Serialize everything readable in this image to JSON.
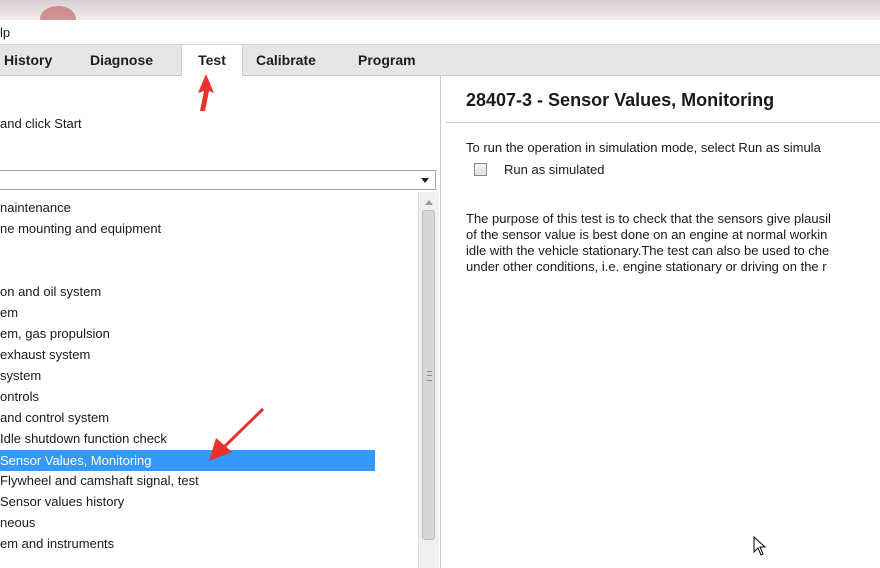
{
  "menubar": {
    "help_fragment": "lp"
  },
  "tabs": [
    {
      "label": "History",
      "active": false
    },
    {
      "label": "Diagnose",
      "active": false
    },
    {
      "label": "Test",
      "active": true
    },
    {
      "label": "Calibrate",
      "active": false
    },
    {
      "label": "Program",
      "active": false
    }
  ],
  "left": {
    "instruction": "and click Start",
    "dropdown_value": "",
    "tree_items": [
      {
        "label": "naintenance",
        "selected": false
      },
      {
        "label": "ne mounting and equipment",
        "selected": false
      },
      {
        "label": "",
        "selected": false
      },
      {
        "label": "",
        "selected": false
      },
      {
        "label": "on and oil system",
        "selected": false
      },
      {
        "label": "em",
        "selected": false
      },
      {
        "label": "em, gas propulsion",
        "selected": false
      },
      {
        "label": " exhaust system",
        "selected": false
      },
      {
        "label": "system",
        "selected": false
      },
      {
        "label": "ontrols",
        "selected": false
      },
      {
        "label": "and control system",
        "selected": false
      },
      {
        "label": " Idle shutdown function check",
        "selected": false
      },
      {
        "label": " Sensor Values, Monitoring",
        "selected": true
      },
      {
        "label": " Flywheel and camshaft signal, test",
        "selected": false
      },
      {
        "label": " Sensor values history",
        "selected": false
      },
      {
        "label": "neous",
        "selected": false
      },
      {
        "label": "em and instruments",
        "selected": false
      }
    ]
  },
  "right": {
    "title": "28407-3 - Sensor Values, Monitoring",
    "simulation_text": "To run the operation in simulation mode, select Run as simula",
    "run_as_simulated": "Run as simulated",
    "run_as_simulated_checked": false,
    "description_lines": [
      "The purpose of this test is to check that the sensors give plausil",
      "of the sensor value is best done on an engine at normal workin",
      "idle with the vehicle stationary.The test can also be used to che",
      "under other conditions, i.e. engine stationary or driving on the r"
    ]
  },
  "colors": {
    "selection": "#3399ff",
    "annotation_arrow": "#e8322b",
    "tab_bar": "#e6e6e6"
  }
}
